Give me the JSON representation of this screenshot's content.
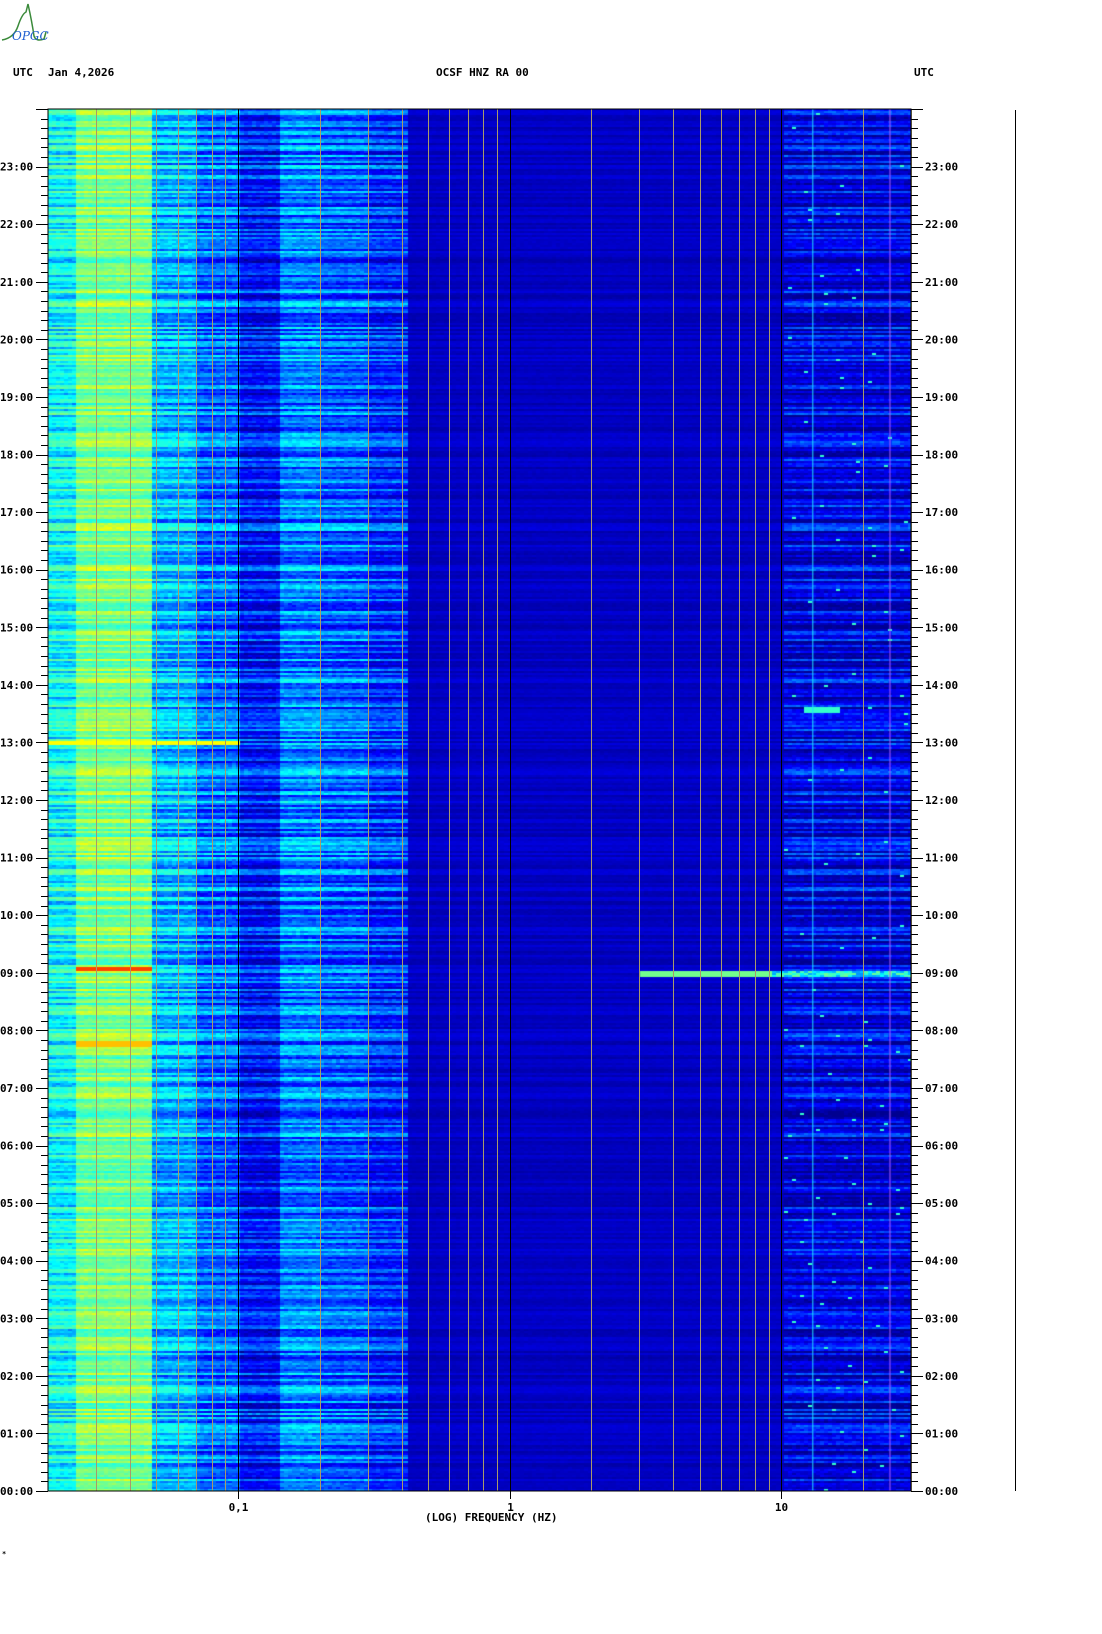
{
  "logo": {
    "text": "OPGC"
  },
  "header": {
    "left_tz": "UTC",
    "date": "Jan 4,2026",
    "station": "OCSF HNZ RA 00",
    "right_tz": "UTC"
  },
  "footer_mark": "*",
  "chart_data": {
    "type": "heatmap",
    "title": "OCSF HNZ RA 00",
    "date": "Jan 4,2026",
    "xlabel": "(LOG) FREQUENCY (HZ)",
    "x_scale": "log",
    "xlim": [
      0.02,
      30
    ],
    "x_ticks": [
      {
        "value": 0.1,
        "label": "0,1"
      },
      {
        "value": 1,
        "label": "1"
      },
      {
        "value": 10,
        "label": "10"
      }
    ],
    "x_gridlines": [
      0.03,
      0.04,
      0.05,
      0.06,
      0.07,
      0.08,
      0.09,
      0.1,
      0.2,
      0.3,
      0.4,
      0.5,
      0.6,
      0.7,
      0.8,
      0.9,
      1,
      2,
      3,
      4,
      5,
      6,
      7,
      8,
      9,
      10,
      20,
      30
    ],
    "ylabel": "UTC",
    "ylim_hours": [
      0,
      24
    ],
    "y_ticks": [
      "00:00",
      "01:00",
      "02:00",
      "03:00",
      "04:00",
      "05:00",
      "06:00",
      "07:00",
      "08:00",
      "09:00",
      "10:00",
      "11:00",
      "12:00",
      "13:00",
      "14:00",
      "15:00",
      "16:00",
      "17:00",
      "18:00",
      "19:00",
      "20:00",
      "21:00",
      "22:00",
      "23:00"
    ],
    "y_minor_tick_minutes": 10,
    "colormap": [
      "#000090",
      "#0000ff",
      "#00ffff",
      "#80ff80",
      "#ffff00",
      "#ff0000"
    ],
    "band_power_levels": [
      {
        "fmin": 0.02,
        "fmax": 0.025,
        "level": 0.45
      },
      {
        "fmin": 0.025,
        "fmax": 0.048,
        "level": 0.62
      },
      {
        "fmin": 0.048,
        "fmax": 0.07,
        "level": 0.36
      },
      {
        "fmin": 0.07,
        "fmax": 0.1,
        "level": 0.27
      },
      {
        "fmin": 0.1,
        "fmax": 0.14,
        "level": 0.17
      },
      {
        "fmin": 0.14,
        "fmax": 0.2,
        "level": 0.3
      },
      {
        "fmin": 0.2,
        "fmax": 0.3,
        "level": 0.26
      },
      {
        "fmin": 0.3,
        "fmax": 0.42,
        "level": 0.2
      },
      {
        "fmin": 0.42,
        "fmax": 10,
        "level": 0.07
      },
      {
        "fmin": 10,
        "fmax": 30,
        "level": 0.12
      }
    ],
    "spectral_lines_hz": [
      13,
      25
    ],
    "events": [
      {
        "time": "09:00",
        "fmin": 3,
        "fmax": 30,
        "level": 0.6
      },
      {
        "time": "13:00",
        "fmin": 0.02,
        "fmax": 0.1,
        "level": 0.8
      },
      {
        "time": "13:35",
        "fmin": 12,
        "fmax": 16,
        "level": 0.5
      },
      {
        "time": "07:47",
        "fmin": 0.025,
        "fmax": 0.048,
        "level": 0.85
      },
      {
        "time": "09:05",
        "fmin": 0.025,
        "fmax": 0.048,
        "level": 0.95
      }
    ]
  }
}
